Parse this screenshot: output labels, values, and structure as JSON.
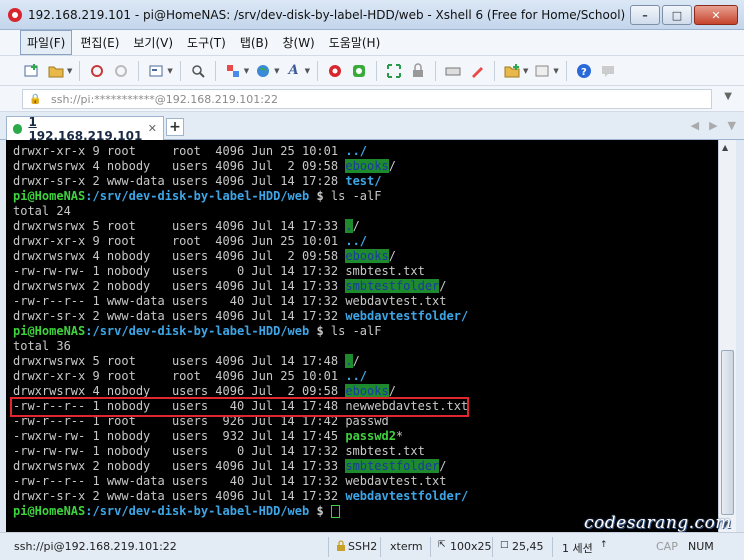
{
  "window": {
    "title": "192.168.219.101 - pi@HomeNAS: /srv/dev-disk-by-label-HDD/web - Xshell 6 (Free for Home/School)"
  },
  "menu": [
    "파일(F)",
    "편집(E)",
    "보기(V)",
    "도구(T)",
    "탭(B)",
    "창(W)",
    "도움말(H)"
  ],
  "address": {
    "text": "ssh://pi:***********@192.168.219.101:22"
  },
  "tab": {
    "num": "1",
    "host": " 192.168.219.101"
  },
  "terminal": {
    "lines": [
      {
        "t": "drwxr-xr-x 9 root     root  4096 Jun 25 10:01 ",
        "d": "../"
      },
      {
        "t": "drwxrwsrwx 4 nobody   users 4096 Jul  2 09:58 ",
        "h": "ebooks",
        "s": "/"
      },
      {
        "t": "drwxr-sr-x 2 www-data users 4096 Jul 14 17:28 ",
        "d": "test/"
      },
      {
        "p": true,
        "cmd": " ls -alF"
      },
      {
        "t": "total 24"
      },
      {
        "t": "drwxrwsrwx 5 root     users 4096 Jul 14 17:33 ",
        "h": ".",
        "s": "/"
      },
      {
        "t": "drwxr-xr-x 9 root     root  4096 Jun 25 10:01 ",
        "d": "../"
      },
      {
        "t": "drwxrwsrwx 4 nobody   users 4096 Jul  2 09:58 ",
        "h": "ebooks",
        "s": "/"
      },
      {
        "t": "-rw-rw-rw- 1 nobody   users    0 Jul 14 17:32 smbtest.txt"
      },
      {
        "t": "drwxrwsrwx 2 nobody   users 4096 Jul 14 17:33 ",
        "h": "smbtestfolder",
        "s": "/"
      },
      {
        "t": "-rw-r--r-- 1 www-data users   40 Jul 14 17:32 webdavtest.txt"
      },
      {
        "t": "drwxr-sr-x 2 www-data users 4096 Jul 14 17:32 ",
        "d": "webdavtestfolder/"
      },
      {
        "p": true,
        "cmd": " ls -alF"
      },
      {
        "t": "total 36"
      },
      {
        "t": "drwxrwsrwx 5 root     users 4096 Jul 14 17:48 ",
        "h": ".",
        "s": "/"
      },
      {
        "t": "drwxr-xr-x 9 root     root  4096 Jun 25 10:01 ",
        "d": "../"
      },
      {
        "t": "drwxrwsrwx 4 nobody   users 4096 Jul  2 09:58 ",
        "h": "ebooks",
        "s": "/"
      },
      {
        "t": "-rw-r--r-- 1 nobody   users   40 Jul 14 17:48 newwebdavtest.txt"
      },
      {
        "t": "-rw-r--r-- 1 root     users  926 Jul 14 17:42 passwd"
      },
      {
        "t": "-rwxrw-rw- 1 nobody   users  932 Jul 14 17:45 ",
        "e": "passwd2",
        "s": "*"
      },
      {
        "t": "-rw-rw-rw- 1 nobody   users    0 Jul 14 17:32 smbtest.txt"
      },
      {
        "t": "drwxrwsrwx 2 nobody   users 4096 Jul 14 17:33 ",
        "h": "smbtestfolder",
        "s": "/"
      },
      {
        "t": "-rw-r--r-- 1 www-data users   40 Jul 14 17:32 webdavtest.txt"
      },
      {
        "t": "drwxr-sr-x 2 www-data users 4096 Jul 14 17:32 ",
        "d": "webdavtestfolder/"
      },
      {
        "p": true,
        "cmd": " ",
        "cursor": true
      }
    ],
    "prompt_user": "pi@HomeNAS",
    "prompt_path": ":/srv/dev-disk-by-label-HDD/web",
    "prompt_sym": " $"
  },
  "status": {
    "ssh_url": "ssh://pi@192.168.219.101:22",
    "protocol": "SSH2",
    "term": "xterm",
    "size": "100x25",
    "pos": "25,45",
    "sessions": "1 세션",
    "cap": "CAP",
    "num": "NUM"
  },
  "watermark": "codesarang.com"
}
